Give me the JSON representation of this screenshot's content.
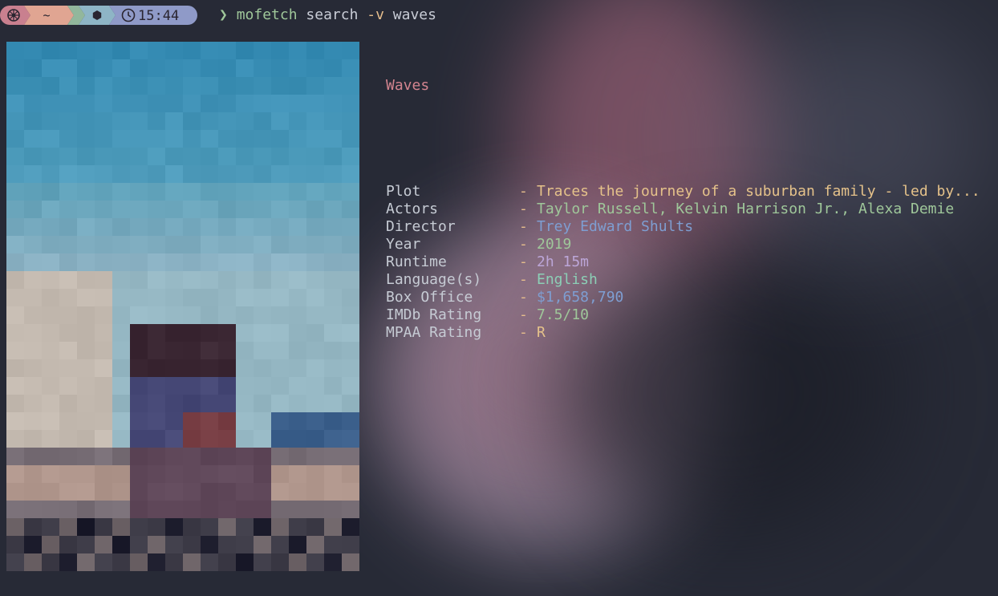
{
  "prompt": {
    "home": "~",
    "time": "15:44",
    "colors": {
      "seg1": "#c9808f",
      "seg2": "#e0a592",
      "seg3": "#92b79c",
      "seg4": "#8eb5c6",
      "seg5": "#8f9ac8"
    },
    "icons": [
      "os-logo-icon",
      "home-icon",
      "node-icon",
      "clock-icon"
    ]
  },
  "command": {
    "prompt_symbol": "❯",
    "program": "mofetch",
    "subcommand": "search",
    "flag": "-v",
    "argument": "waves"
  },
  "movie": {
    "title": "Waves",
    "fields": [
      {
        "label": "Plot",
        "value": "Traces the journey of a suburban family - led by...",
        "color": "#e5c28a"
      },
      {
        "label": "Actors",
        "value": "Taylor Russell, Kelvin Harrison Jr., Alexa Demie",
        "color": "#9fc79a"
      },
      {
        "label": "Director",
        "value": "Trey Edward Shults",
        "color": "#7e9ed2"
      },
      {
        "label": "Year",
        "value": "2019",
        "color": "#9fc79a"
      },
      {
        "label": "Runtime",
        "value": "2h 15m",
        "color": "#bca6d8"
      },
      {
        "label": "Language(s)",
        "value": "English",
        "color": "#8ccfb6"
      },
      {
        "label": "Box Office",
        "value": "$1,658,790",
        "color": "#7e9ed2"
      },
      {
        "label": "IMDb Rating",
        "value": "7.5/10",
        "color": "#9fc79a"
      },
      {
        "label": "MPAA Rating",
        "value": "R",
        "color": "#e5c28a"
      }
    ],
    "separator": "-"
  },
  "theme": {
    "background": "#272a36",
    "label_color": "#c6cbd4",
    "separator_color": "#e5bd8c",
    "title_color": "#d3848f"
  }
}
